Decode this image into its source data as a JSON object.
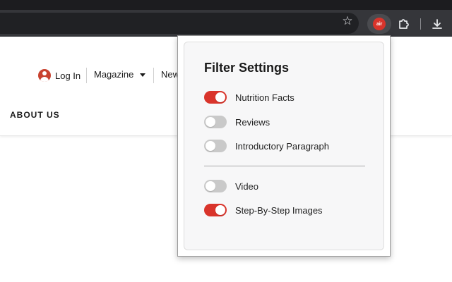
{
  "browser": {
    "extension_logo_text": "air",
    "icons": [
      "star-icon",
      "extension-icon",
      "puzzle-icon",
      "download-icon"
    ]
  },
  "site": {
    "login_label": "Log In",
    "magazine_label": "Magazine",
    "newsletter_label": "New",
    "about_label": "ABOUT US",
    "accent": "#c8422f"
  },
  "popup": {
    "title": "Filter Settings",
    "accent": "#d9342b",
    "toggles": [
      {
        "label": "Nutrition Facts",
        "on": true
      },
      {
        "label": "Reviews",
        "on": false
      },
      {
        "label": "Introductory Paragraph",
        "on": false
      },
      {
        "label": "Video",
        "on": false
      },
      {
        "label": "Step-By-Step Images",
        "on": true
      }
    ]
  }
}
